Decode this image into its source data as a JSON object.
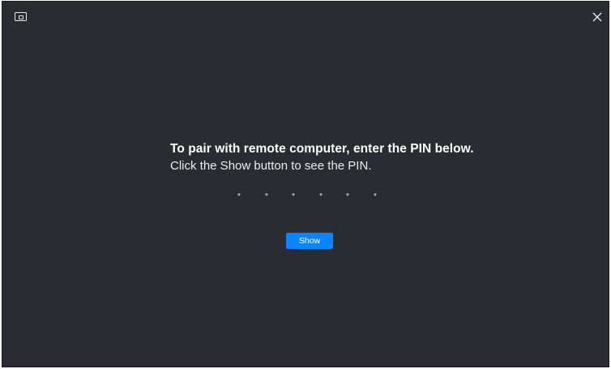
{
  "window": {
    "app_icon": "display-icon",
    "close_icon": "close-icon"
  },
  "pairing": {
    "headline": "To pair with remote computer, enter the PIN below.",
    "instruction": "Click the Show button to see the PIN.",
    "pin_mask": [
      "*",
      "*",
      "*",
      "*",
      "*",
      "*"
    ],
    "show_button_label": "Show"
  },
  "colors": {
    "background": "#2a2c31",
    "accent": "#0a84ff",
    "text": "#ffffff"
  }
}
